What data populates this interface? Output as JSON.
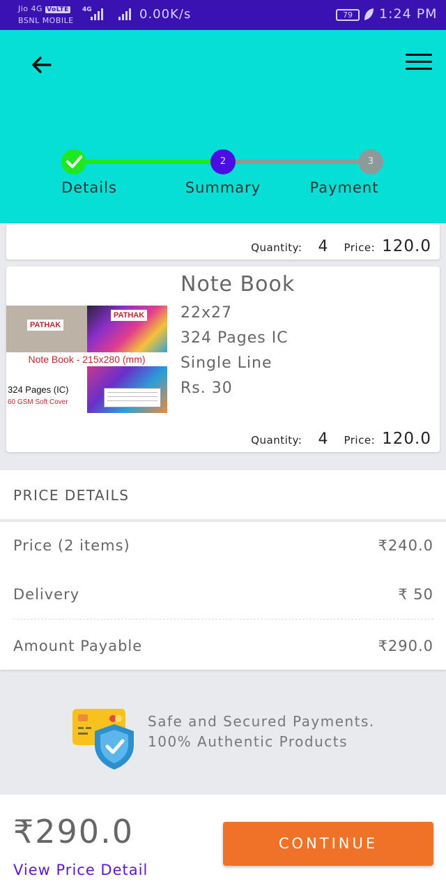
{
  "status_bar": {
    "carrier_1": "Jio 4G",
    "volte": "VoLTE",
    "carrier_2": "BSNL MOBILE",
    "network_type": "4G",
    "speed": "0.00K/s",
    "battery": "79",
    "time": "1:24 PM"
  },
  "header": {
    "back_icon": "arrow-left-icon",
    "menu_icon": "hamburger-menu-icon",
    "accent_color": "#06dfd6"
  },
  "stepper": {
    "steps": [
      {
        "label": "Details",
        "marker": "",
        "state": "done"
      },
      {
        "label": "Summary",
        "marker": "2",
        "state": "current"
      },
      {
        "label": "Payment",
        "marker": "3",
        "state": "pending"
      }
    ]
  },
  "items": [
    {
      "quantity_label": "Quantity:",
      "quantity": "4",
      "price_label": "Price:",
      "price": "120.0"
    },
    {
      "title": "Note Book",
      "size": "22x27",
      "pages": "324 Pages IC",
      "ruling": "Single Line",
      "unit_price": "Rs. 30",
      "quantity_label": "Quantity:",
      "quantity": "4",
      "price_label": "Price:",
      "price": "120.0",
      "image": {
        "brand": "PATHAK",
        "banner": "Note Book - 215x280 (mm)",
        "pages": "324 Pages (IC)",
        "cover": "60 GSM Soft Cover"
      }
    }
  ],
  "price_details": {
    "title": "PRICE DETAILS",
    "rows": [
      {
        "label": "Price (2 items)",
        "value": "₹240.0"
      },
      {
        "label": "Delivery",
        "value": "₹ 50"
      },
      {
        "label": "Amount Payable",
        "value": "₹290.0"
      }
    ]
  },
  "assurance": {
    "line1": "Safe and Secured Payments.",
    "line2": "100% Authentic Products",
    "icon": "secure-card-shield-icon"
  },
  "footer": {
    "total": "₹290.0",
    "view_detail": "View Price Detail",
    "continue": "CONTINUE",
    "button_color": "#f07228"
  }
}
